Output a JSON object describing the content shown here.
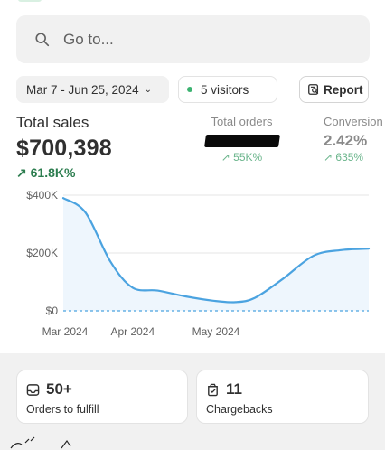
{
  "search": {
    "placeholder": "Go to..."
  },
  "filters": {
    "date_range": "Mar 7 - Jun 25, 2024",
    "visitors": "5 visitors",
    "report_label": "Report"
  },
  "metrics": {
    "total_sales": {
      "label": "Total sales",
      "value": "$700,398",
      "change": "61.8K%"
    },
    "total_orders": {
      "label": "Total orders",
      "change": "55K%"
    },
    "conversion": {
      "label": "Conversion",
      "value": "2.42%",
      "change": "635%"
    }
  },
  "chart_data": {
    "type": "line",
    "x_ticks": [
      "Mar 2024",
      "Apr 2024",
      "May 2024"
    ],
    "y_ticks": [
      "$400K",
      "$200K",
      "$0"
    ],
    "ylim": [
      0,
      400000
    ],
    "grid": true,
    "series": [
      {
        "values": [
          [
            "2024-03-07",
            390000
          ],
          [
            "2024-03-15",
            340000
          ],
          [
            "2024-03-24",
            170000
          ],
          [
            "2024-04-01",
            80000
          ],
          [
            "2024-04-10",
            70000
          ],
          [
            "2024-04-20",
            50000
          ],
          [
            "2024-04-30",
            35000
          ],
          [
            "2024-05-08",
            30000
          ],
          [
            "2024-05-15",
            45000
          ],
          [
            "2024-05-25",
            110000
          ],
          [
            "2024-06-05",
            190000
          ],
          [
            "2024-06-15",
            210000
          ],
          [
            "2024-06-25",
            215000
          ]
        ]
      },
      {
        "values": [
          [
            "2024-03-07",
            0
          ],
          [
            "2024-06-25",
            0
          ]
        ],
        "style": "dashed"
      }
    ],
    "colors": {
      "line": "#4ba3e0",
      "area": "#eef6fd",
      "grid": "#e6e6e6"
    }
  },
  "cards": [
    {
      "value": "50+",
      "label": "Orders to fulfill"
    },
    {
      "value": "11",
      "label": "Chargebacks"
    }
  ]
}
